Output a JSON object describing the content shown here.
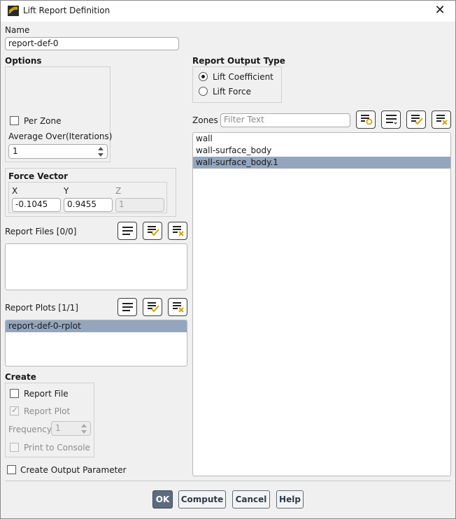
{
  "window": {
    "title": "Lift Report Definition"
  },
  "name": {
    "label": "Name",
    "value": "report-def-0"
  },
  "options": {
    "title": "Options",
    "per_zone_label": "Per Zone",
    "per_zone_checked": false,
    "average_over_label": "Average Over(Iterations)",
    "average_over_value": "1"
  },
  "force_vector": {
    "title": "Force Vector",
    "x_label": "X",
    "y_label": "Y",
    "z_label": "Z",
    "x_value": "-0.1045",
    "y_value": "0.9455",
    "z_value": "1"
  },
  "report_files": {
    "label": "Report Files",
    "count": "[0/0]",
    "items": []
  },
  "report_plots": {
    "label": "Report Plots",
    "count": "[1/1]",
    "items": [
      "report-def-0-rplot"
    ]
  },
  "create": {
    "title": "Create",
    "report_file_label": "Report File",
    "report_file_checked": false,
    "report_plot_label": "Report Plot",
    "report_plot_checked": true,
    "frequency_label": "Frequency",
    "frequency_value": "1",
    "print_console_label": "Print to Console",
    "print_console_checked": false
  },
  "create_output_param": {
    "label": "Create Output Parameter",
    "checked": false
  },
  "report_output_type": {
    "title": "Report Output Type",
    "options": [
      {
        "label": "Lift Coefficient",
        "selected": true
      },
      {
        "label": "Lift Force",
        "selected": false
      }
    ]
  },
  "zones": {
    "label": "Zones",
    "filter_placeholder": "Filter Text",
    "items": [
      {
        "label": "wall",
        "selected": false
      },
      {
        "label": "wall-surface_body",
        "selected": false
      },
      {
        "label": "wall-surface_body.1",
        "selected": true
      }
    ]
  },
  "buttons": {
    "ok": "OK",
    "compute": "Compute",
    "cancel": "Cancel",
    "help": "Help"
  },
  "colors": {
    "selection": "#93a6bd",
    "primary_button": "#5d6b7e",
    "icon_accent": "#d9a400"
  }
}
